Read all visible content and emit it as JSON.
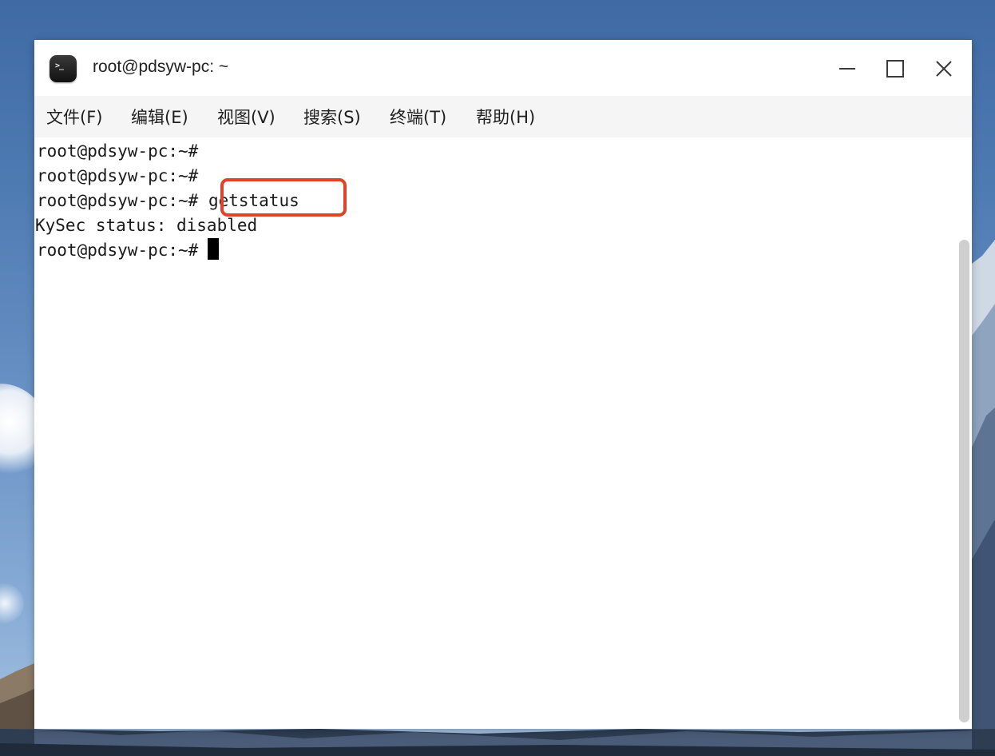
{
  "window": {
    "title": "root@pdsyw-pc: ~",
    "app_icon": "terminal-icon",
    "app_icon_glyph": ">_",
    "controls": [
      "minimize-icon",
      "maximize-icon",
      "close-icon"
    ]
  },
  "menubar": {
    "items": [
      {
        "label": "文件(F)"
      },
      {
        "label": "编辑(E)"
      },
      {
        "label": "视图(V)"
      },
      {
        "label": "搜索(S)"
      },
      {
        "label": "终端(T)"
      },
      {
        "label": "帮助(H)"
      }
    ]
  },
  "terminal": {
    "lines": [
      {
        "prompt": "root@pdsyw-pc:~#",
        "command": ""
      },
      {
        "prompt": "root@pdsyw-pc:~#",
        "command": ""
      },
      {
        "prompt": "root@pdsyw-pc:~#",
        "command": "getstatus"
      },
      {
        "output": "KySec status: disabled"
      },
      {
        "prompt": "root@pdsyw-pc:~#",
        "command": ""
      }
    ]
  },
  "colors": {
    "highlight": "#e0432c",
    "terminal_text": "#1a1a1a",
    "menubar_bg": "#f5f5f5"
  }
}
